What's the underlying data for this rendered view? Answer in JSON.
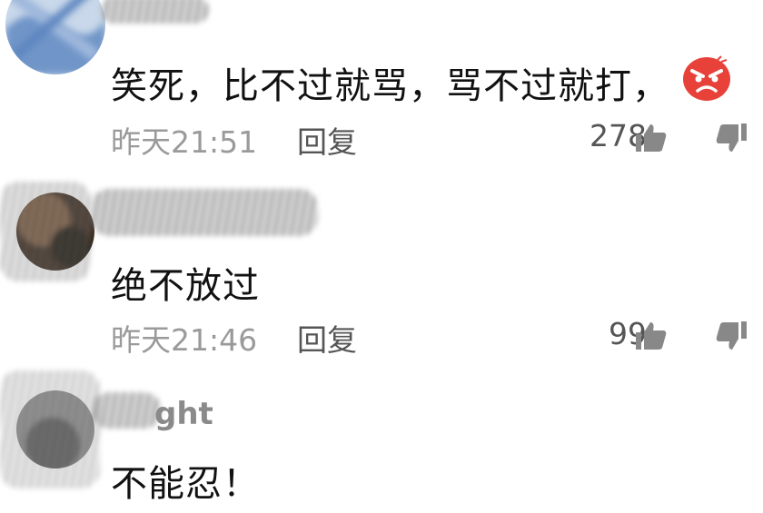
{
  "comments": [
    {
      "username_partial": "",
      "text": "笑死，比不过就骂，骂不过就打，",
      "time": "昨天21:51",
      "reply": "回复",
      "likes": "278",
      "emoji": "angry-face-emoji"
    },
    {
      "username_partial": "",
      "text": "绝不放过",
      "time": "昨天21:46",
      "reply": "回复",
      "likes": "99"
    },
    {
      "username_partial": "ght",
      "text": "不能忍！"
    }
  ],
  "icons": {
    "like": "thumb-up-icon",
    "dislike": "thumb-down-icon"
  },
  "colors": {
    "text": "#111111",
    "meta": "#9a9a9a",
    "emoji": "#e8413a"
  }
}
